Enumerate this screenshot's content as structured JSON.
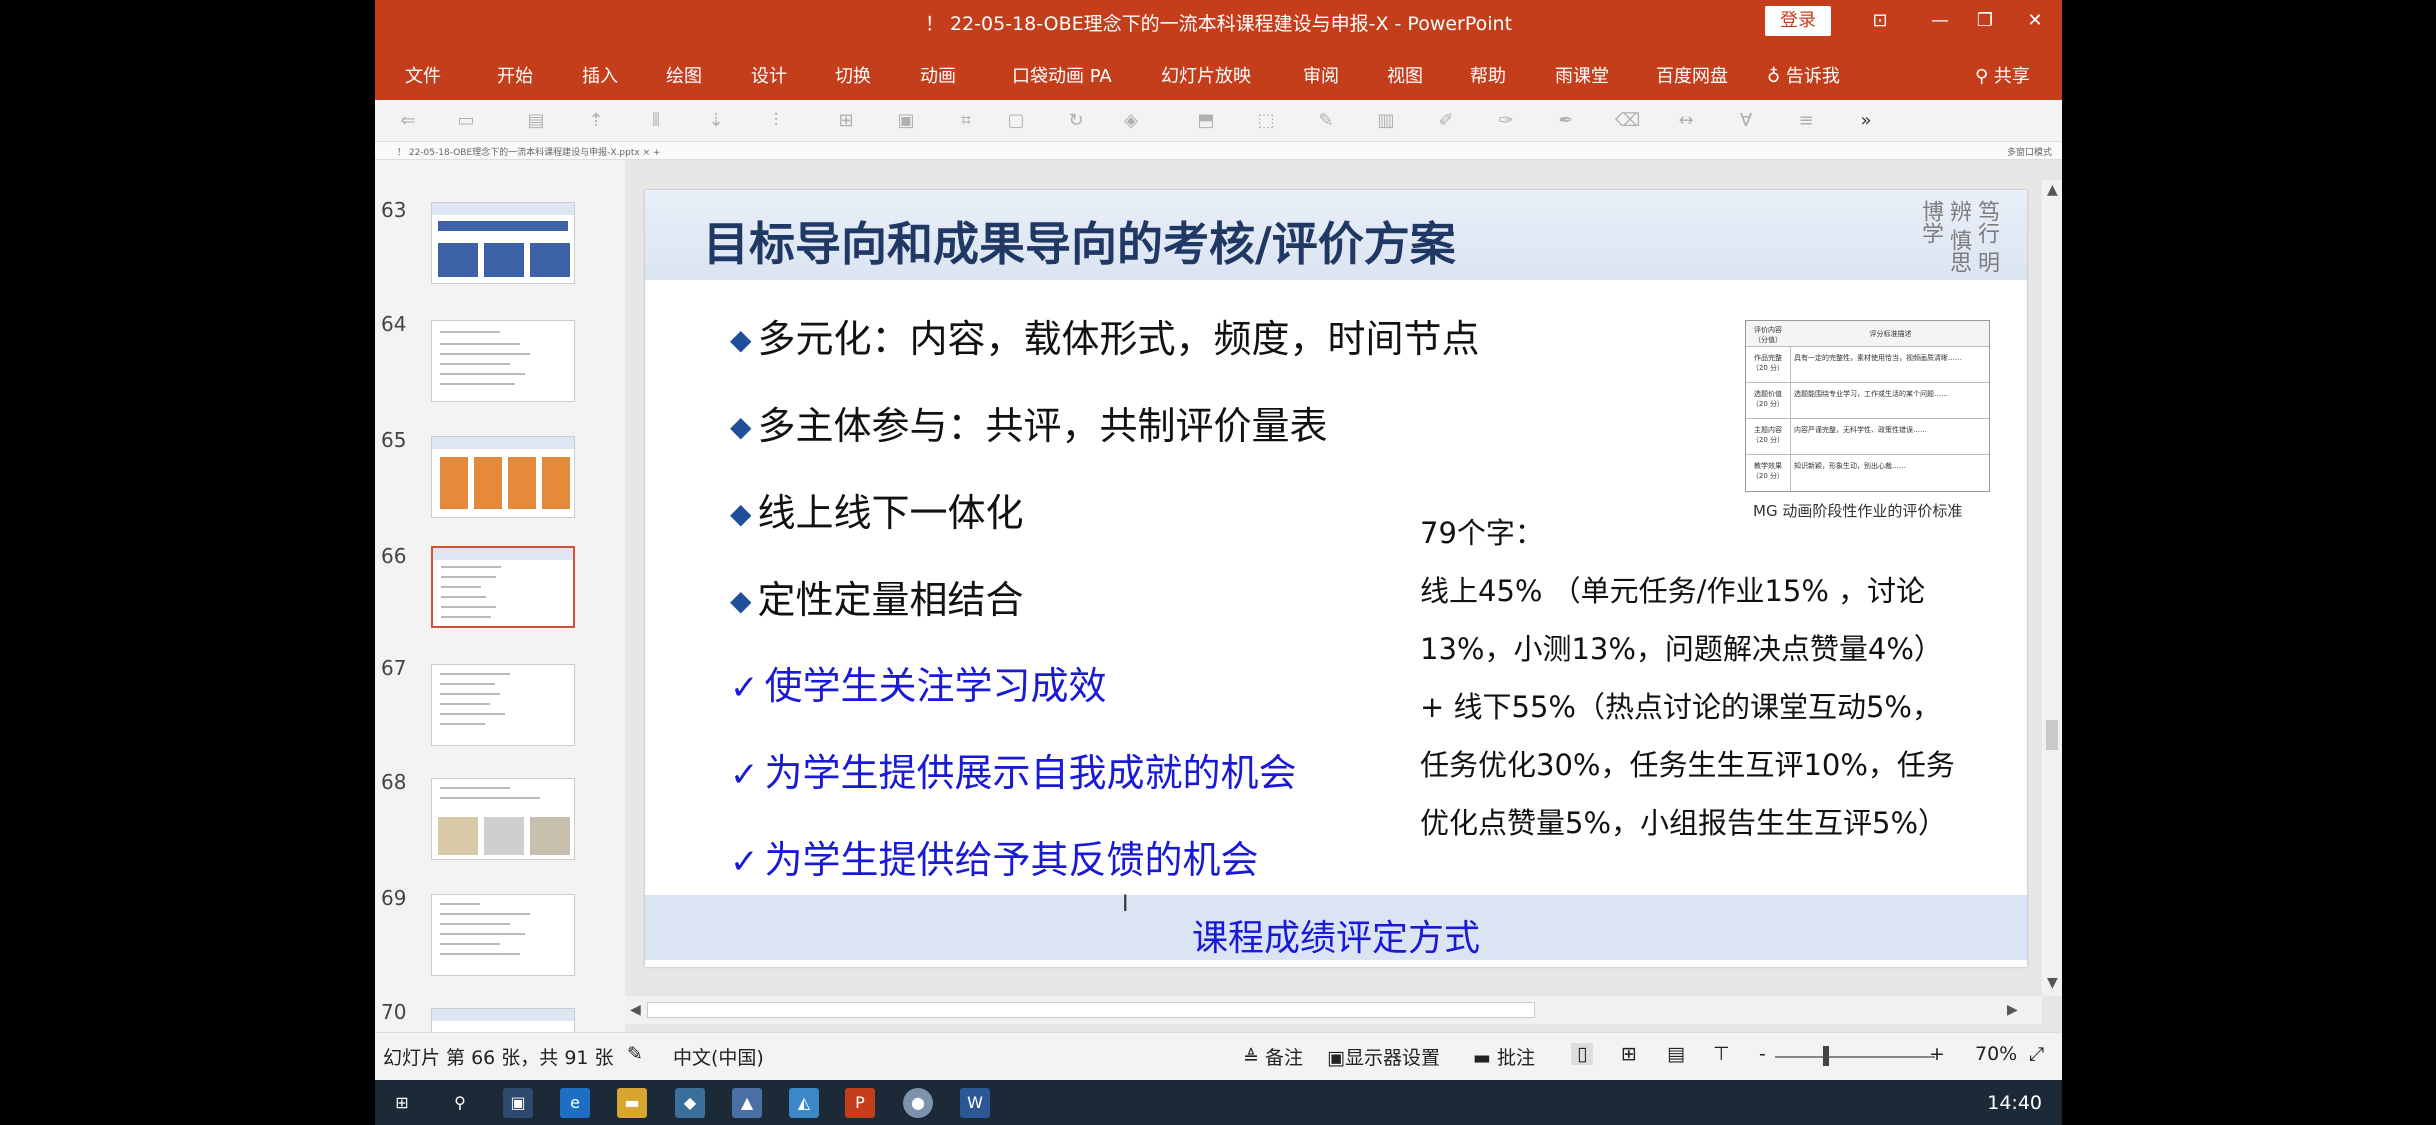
{
  "window": {
    "title": "！ 22-05-18-OBE理念下的一流本科课程建设与申报-X  -  PowerPoint",
    "login_label": "登录",
    "controls": [
      "⊡",
      "—",
      "❐",
      "✕"
    ]
  },
  "ribbon": {
    "tabs": [
      "文件",
      "开始",
      "插入",
      "绘图",
      "设计",
      "切换",
      "动画",
      "口袋动画 PA",
      "幻灯片放映",
      "审阅",
      "视图",
      "帮助",
      "雨课堂",
      "百度网盘",
      "告诉我",
      "共享"
    ]
  },
  "docstrip": {
    "tab_text": "！ 22-05-18-OBE理念下的一流本科课程建设与申报-X.pptx  ×  +",
    "right_text": "多窗口模式"
  },
  "thumbnails": {
    "numbers": [
      "63",
      "64",
      "65",
      "66",
      "67",
      "68",
      "69",
      "70"
    ],
    "active": "66"
  },
  "slide": {
    "title": "目标导向和成果导向的考核/评价方案",
    "calligraphy": "笃行 明辨 慎思 博学",
    "bullets": [
      {
        "mark": "◆",
        "text": "多元化：内容，载体形式，频度，时间节点"
      },
      {
        "mark": "◆",
        "text": "多主体参与：共评，共制评价量表"
      },
      {
        "mark": "◆",
        "text": "线上线下一体化"
      },
      {
        "mark": "◆",
        "text": "定性定量相结合"
      },
      {
        "mark": "✓",
        "text": "使学生关注学习成效"
      },
      {
        "mark": "✓",
        "text": "为学生提供展示自我成就的机会"
      },
      {
        "mark": "✓",
        "text": "为学生提供给予其反馈的机会"
      }
    ],
    "note_lines": [
      "79个字：",
      "线上45%  （单元任务/作业15%  ，讨论",
      "13%，小测13%，问题解决点赞量4%）",
      "+ 线下55%（热点讨论的课堂互动5%，",
      "任务优化30%，任务生生互评10%，任务",
      "优化点赞量5%，小组报告生生互评5%）"
    ],
    "table_header": [
      "评价内容（分值）",
      "评分标准描述"
    ],
    "table_rows": [
      [
        "作品完整（20 分）",
        "具有一定的完整性，素材使用恰当，视频画质清晰……"
      ],
      [
        "选题价值（20 分）",
        "选题能围绕专业学习，工作或生活的某个问题……"
      ],
      [
        "主题内容（20 分）",
        "内容严谨完整，无科学性、政策性错误……"
      ],
      [
        "教学效果（20 分）",
        "知识新颖，形象生动，别出心裁……"
      ]
    ],
    "table_caption": "MG 动画阶段性作业的评价标准",
    "footer": "课程成绩评定方式"
  },
  "statusbar": {
    "slide_info": "幻灯片 第 66 张，共 91 张",
    "language": "中文(中国)",
    "notes_label": "备注",
    "display_label": "显示器设置",
    "comments_label": "批注",
    "zoom_minus": "-",
    "zoom_plus": "+",
    "zoom": "70%"
  },
  "taskbar": {
    "clock": "14:40"
  },
  "colors": {
    "accent": "#c43e1c",
    "slide_title": "#203864",
    "check_text": "#1a1ad6"
  }
}
